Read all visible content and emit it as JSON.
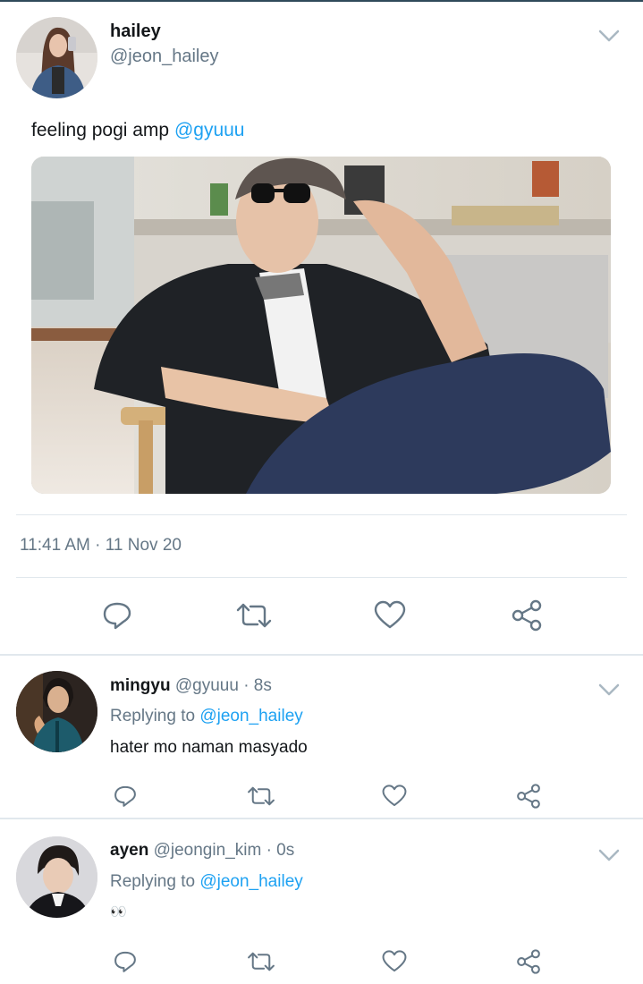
{
  "main_tweet": {
    "name": "hailey",
    "handle": "@jeon_hailey",
    "text": "feeling pogi amp ",
    "mention": "@gyuuu",
    "timestamp": "11:41 AM · 11 Nov 20"
  },
  "replies": [
    {
      "name": "mingyu",
      "handle": "@gyuuu",
      "time": "· 8s",
      "replying_prefix": "Replying to ",
      "replying_to": "@jeon_hailey",
      "text": "hater mo naman masyado"
    },
    {
      "name": "ayen",
      "handle": "@jeongin_kim",
      "time": "· 0s",
      "replying_prefix": "Replying to ",
      "replying_to": "@jeon_hailey",
      "text": "👀"
    }
  ],
  "icons": [
    "chevron-down-icon",
    "reply-icon",
    "retweet-icon",
    "like-icon",
    "share-icon"
  ],
  "colors": {
    "link": "#1da1f2",
    "secondary": "#657786",
    "icon": "#657786",
    "divider": "#e1e8ed"
  }
}
